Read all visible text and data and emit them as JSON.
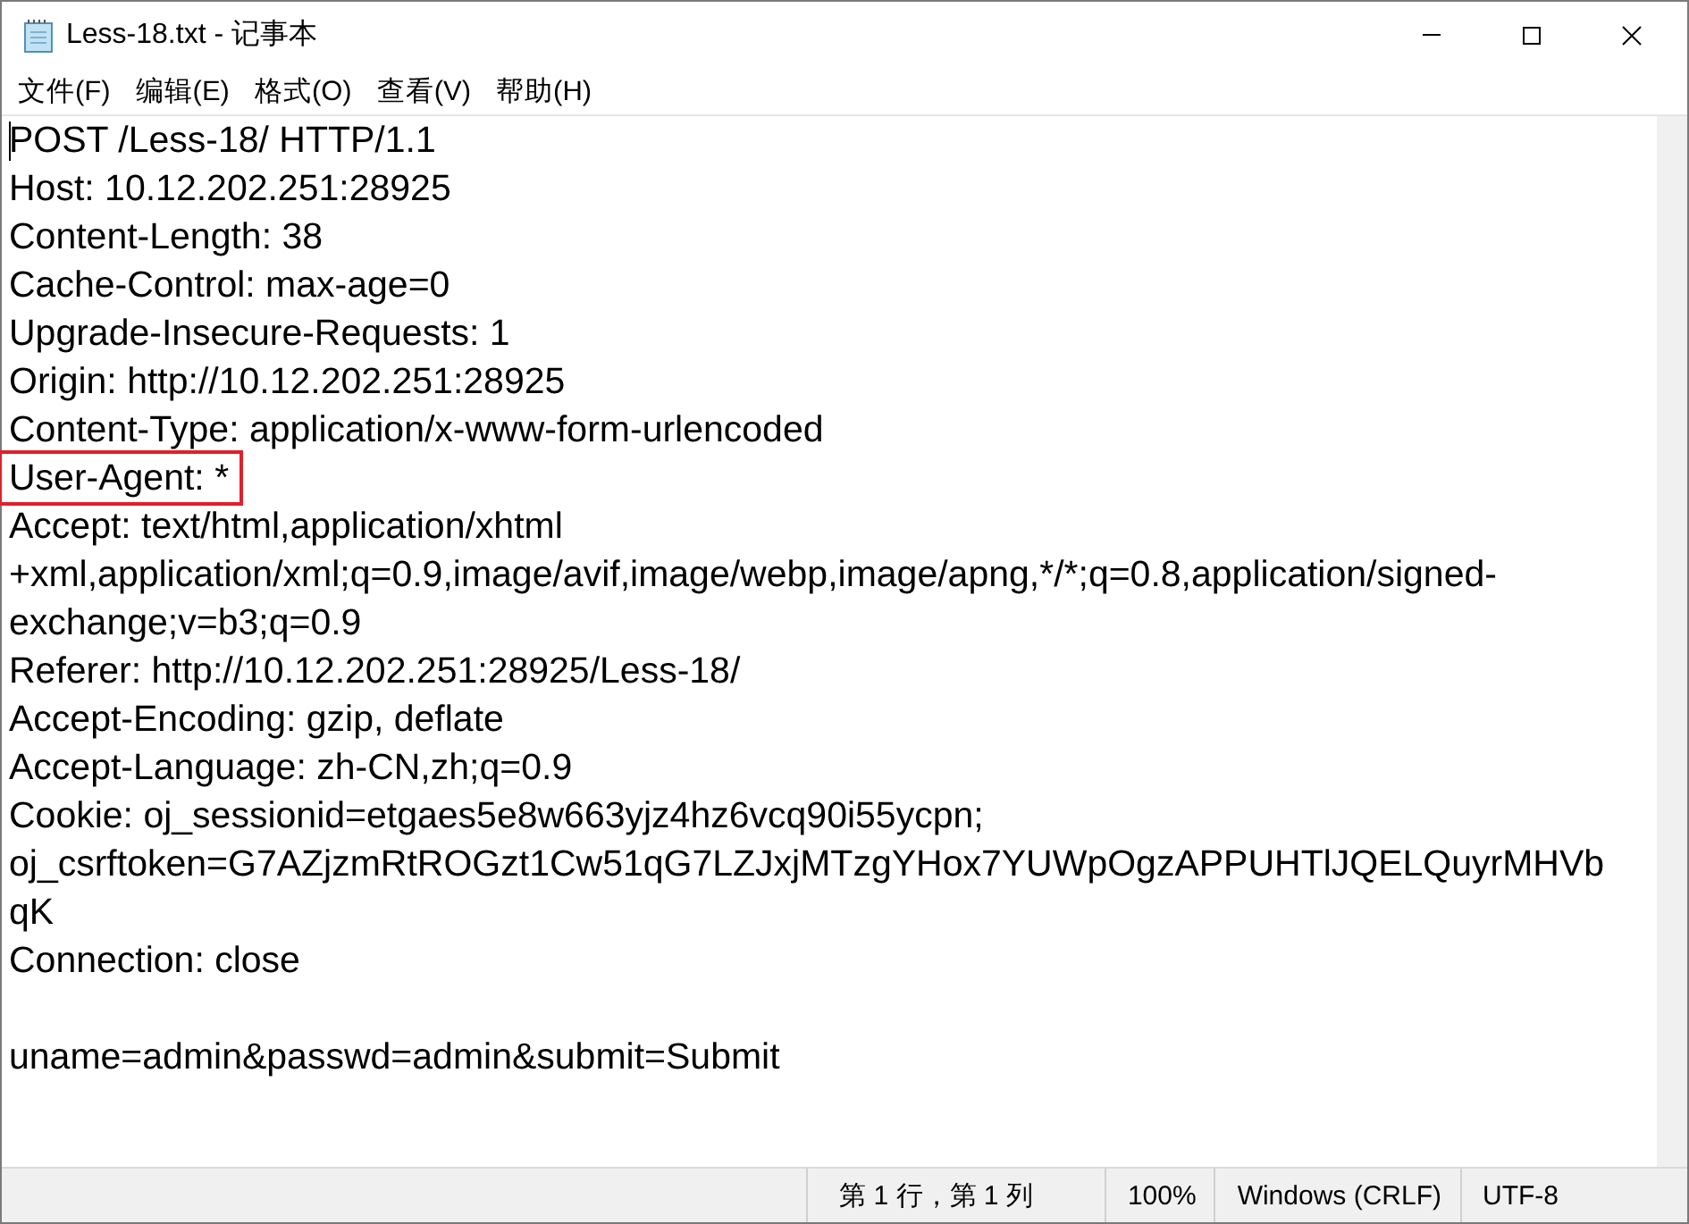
{
  "window": {
    "title": "Less-18.txt - 记事本"
  },
  "menu": [
    "文件(F)",
    "编辑(E)",
    "格式(O)",
    "查看(V)",
    "帮助(H)"
  ],
  "lines": [
    {
      "text": "POST /Less-18/ HTTP/1.1",
      "marked": false
    },
    {
      "text": "Host: 10.12.202.251:28925",
      "marked": false
    },
    {
      "text": "Content-Length: 38",
      "marked": false
    },
    {
      "text": "Cache-Control: max-age=0",
      "marked": false
    },
    {
      "text": "Upgrade-Insecure-Requests: 1",
      "marked": false
    },
    {
      "text": "Origin: http://10.12.202.251:28925",
      "marked": false
    },
    {
      "text": "Content-Type: application/x-www-form-urlencoded",
      "marked": false
    },
    {
      "text": "User-Agent: *",
      "marked": true
    },
    {
      "text": "Accept: text/html,application/xhtml",
      "marked": false
    },
    {
      "text": "+xml,application/xml;q=0.9,image/avif,image/webp,image/apng,*/*;q=0.8,application/signed-",
      "marked": false
    },
    {
      "text": "exchange;v=b3;q=0.9",
      "marked": false
    },
    {
      "text": "Referer: http://10.12.202.251:28925/Less-18/",
      "marked": false
    },
    {
      "text": "Accept-Encoding: gzip, deflate",
      "marked": false
    },
    {
      "text": "Accept-Language: zh-CN,zh;q=0.9",
      "marked": false
    },
    {
      "text": "Cookie: oj_sessionid=etgaes5e8w663yjz4hz6vcq90i55ycpn;",
      "marked": false
    },
    {
      "text": "oj_csrftoken=G7AZjzmRtROGzt1Cw51qG7LZJxjMTzgYHox7YUWpOgzAPPUHTlJQELQuyrMHVb",
      "marked": false
    },
    {
      "text": "qK",
      "marked": false
    },
    {
      "text": "Connection: close",
      "marked": false
    }
  ],
  "body_lines": [
    "uname=admin&passwd=admin&submit=Submit"
  ],
  "status_bar": {
    "position": "第 1 行，第 1 列",
    "zoom": "100%",
    "line_ending": "Windows (CRLF)",
    "encoding": "UTF-8"
  }
}
